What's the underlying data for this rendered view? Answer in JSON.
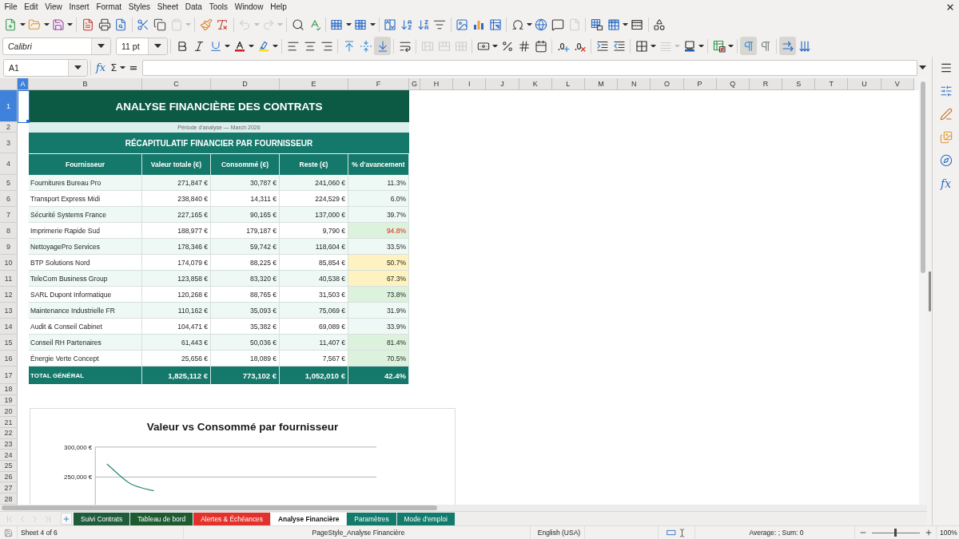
{
  "menu": [
    "File",
    "Edit",
    "View",
    "Insert",
    "Format",
    "Styles",
    "Sheet",
    "Data",
    "Tools",
    "Window",
    "Help"
  ],
  "toolbar_standard": [
    [
      {
        "kind": "new",
        "dropdown": true,
        "disabled": false
      },
      {
        "kind": "open",
        "dropdown": true,
        "disabled": false
      },
      {
        "kind": "save",
        "dropdown": true,
        "disabled": false
      }
    ],
    [
      {
        "kind": "export_pdf",
        "dropdown": false,
        "disabled": false
      },
      {
        "kind": "print",
        "dropdown": false,
        "disabled": false
      },
      {
        "kind": "print_preview",
        "dropdown": false,
        "disabled": false
      }
    ],
    [
      {
        "kind": "cut",
        "dropdown": false,
        "disabled": false
      },
      {
        "kind": "copy",
        "dropdown": false,
        "disabled": false
      },
      {
        "kind": "paste",
        "dropdown": true,
        "disabled": true
      }
    ],
    [
      {
        "kind": "clone",
        "dropdown": false,
        "disabled": false
      },
      {
        "kind": "clear",
        "dropdown": false,
        "disabled": false
      }
    ],
    [
      {
        "kind": "undo",
        "dropdown": true,
        "disabled": true
      },
      {
        "kind": "redo",
        "dropdown": true,
        "disabled": true
      }
    ],
    [
      {
        "kind": "find",
        "dropdown": false,
        "disabled": false
      },
      {
        "kind": "spelling",
        "dropdown": false,
        "disabled": false
      }
    ],
    [
      {
        "kind": "rows",
        "dropdown": true,
        "disabled": false
      },
      {
        "kind": "columns",
        "dropdown": true,
        "disabled": false
      }
    ],
    [
      {
        "kind": "sort",
        "dropdown": false,
        "disabled": false
      },
      {
        "kind": "sort_ascending",
        "dropdown": false,
        "disabled": false
      },
      {
        "kind": "sort_descending",
        "dropdown": false,
        "disabled": false
      },
      {
        "kind": "autofilter",
        "dropdown": false,
        "disabled": false
      }
    ],
    [
      {
        "kind": "image",
        "dropdown": false,
        "disabled": false
      },
      {
        "kind": "chart",
        "dropdown": false,
        "disabled": false
      },
      {
        "kind": "pivot_table",
        "dropdown": false,
        "disabled": false
      }
    ],
    [
      {
        "kind": "special_character",
        "dropdown": true,
        "disabled": false
      },
      {
        "kind": "hyperlink",
        "dropdown": false,
        "disabled": false
      },
      {
        "kind": "comment",
        "dropdown": false,
        "disabled": false
      },
      {
        "kind": "header_footer",
        "dropdown": false,
        "disabled": true
      }
    ],
    [
      {
        "kind": "print_area",
        "dropdown": false,
        "disabled": false
      },
      {
        "kind": "freeze",
        "dropdown": true,
        "disabled": false
      },
      {
        "kind": "split_window",
        "dropdown": false,
        "disabled": false
      }
    ],
    [
      {
        "kind": "draw_functions",
        "dropdown": false,
        "disabled": false
      }
    ]
  ],
  "font_name": "Calibri",
  "font_size": "11 pt",
  "toolbar_formatting": [
    [
      {
        "kind": "bold",
        "dropdown": false,
        "disabled": false,
        "pressed": false
      },
      {
        "kind": "italic",
        "dropdown": false,
        "disabled": false,
        "pressed": false
      },
      {
        "kind": "underline",
        "dropdown": true,
        "disabled": false,
        "pressed": false
      },
      {
        "kind": "font_color",
        "dropdown": true,
        "disabled": false,
        "pressed": false
      },
      {
        "kind": "highlight",
        "dropdown": true,
        "disabled": false,
        "pressed": false
      }
    ],
    [
      {
        "kind": "align_left",
        "dropdown": false,
        "disabled": false,
        "pressed": false
      },
      {
        "kind": "align_center",
        "dropdown": false,
        "disabled": false,
        "pressed": false
      },
      {
        "kind": "align_right",
        "dropdown": false,
        "disabled": false,
        "pressed": false
      }
    ],
    [
      {
        "kind": "align_top",
        "dropdown": false,
        "disabled": false,
        "pressed": false
      },
      {
        "kind": "align_middle",
        "dropdown": false,
        "disabled": false,
        "pressed": false
      },
      {
        "kind": "align_bottom",
        "dropdown": false,
        "disabled": false,
        "pressed": true
      }
    ],
    [
      {
        "kind": "wrap",
        "dropdown": false,
        "disabled": false,
        "pressed": false
      }
    ],
    [
      {
        "kind": "merge_center",
        "dropdown": false,
        "disabled": true,
        "pressed": false
      },
      {
        "kind": "merge",
        "dropdown": false,
        "disabled": true,
        "pressed": false
      },
      {
        "kind": "unmerge",
        "dropdown": false,
        "disabled": true,
        "pressed": false
      }
    ],
    [
      {
        "kind": "currency",
        "dropdown": true,
        "disabled": false,
        "pressed": false
      },
      {
        "kind": "percent",
        "dropdown": false,
        "disabled": false,
        "pressed": false
      },
      {
        "kind": "number",
        "dropdown": false,
        "disabled": false,
        "pressed": false
      },
      {
        "kind": "date",
        "dropdown": false,
        "disabled": false,
        "pressed": false
      }
    ],
    [
      {
        "kind": "add_decimal",
        "dropdown": false,
        "disabled": false,
        "pressed": false
      },
      {
        "kind": "delete_decimal",
        "dropdown": false,
        "disabled": false,
        "pressed": false
      }
    ],
    [
      {
        "kind": "indent_increase",
        "dropdown": false,
        "disabled": false,
        "pressed": false
      },
      {
        "kind": "indent_decrease",
        "dropdown": false,
        "disabled": false,
        "pressed": false
      }
    ],
    [
      {
        "kind": "borders",
        "dropdown": true,
        "disabled": false,
        "pressed": false
      },
      {
        "kind": "border_style",
        "dropdown": true,
        "disabled": true,
        "pressed": false
      },
      {
        "kind": "border_color",
        "dropdown": true,
        "disabled": false,
        "pressed": false
      }
    ],
    [
      {
        "kind": "conditional",
        "dropdown": true,
        "disabled": false,
        "pressed": false
      }
    ],
    [
      {
        "kind": "ltr",
        "dropdown": false,
        "disabled": false,
        "pressed": true
      },
      {
        "kind": "rtl",
        "dropdown": false,
        "disabled": false,
        "pressed": false
      }
    ],
    [
      {
        "kind": "text_ltr",
        "dropdown": false,
        "disabled": false,
        "pressed": true
      },
      {
        "kind": "text_vertical",
        "dropdown": false,
        "disabled": false,
        "pressed": false
      }
    ]
  ],
  "formula_bar": {
    "name_box": "A1",
    "function_wizard": "fx",
    "sum": "Σ",
    "equals": "="
  },
  "sheet": {
    "column_headers": [
      {
        "label": "A",
        "selected": true
      },
      {
        "label": "B",
        "selected": false
      },
      {
        "label": "C",
        "selected": false
      },
      {
        "label": "D",
        "selected": false
      },
      {
        "label": "E",
        "selected": false
      },
      {
        "label": "F",
        "selected": false
      },
      {
        "label": "G",
        "selected": false
      },
      {
        "label": "H",
        "selected": false
      },
      {
        "label": "I",
        "selected": false
      },
      {
        "label": "J",
        "selected": false
      },
      {
        "label": "K",
        "selected": false
      },
      {
        "label": "L",
        "selected": false
      },
      {
        "label": "M",
        "selected": false
      },
      {
        "label": "N",
        "selected": false
      },
      {
        "label": "O",
        "selected": false
      },
      {
        "label": "P",
        "selected": false
      },
      {
        "label": "Q",
        "selected": false
      },
      {
        "label": "R",
        "selected": false
      },
      {
        "label": "S",
        "selected": false
      },
      {
        "label": "T",
        "selected": false
      },
      {
        "label": "U",
        "selected": false
      },
      {
        "label": "V",
        "selected": false
      }
    ],
    "row_headers": [
      {
        "label": "1",
        "selected": true
      },
      {
        "label": "2",
        "selected": false
      },
      {
        "label": "3",
        "selected": false
      },
      {
        "label": "4",
        "selected": false
      },
      {
        "label": "5",
        "selected": false
      },
      {
        "label": "6",
        "selected": false
      },
      {
        "label": "7",
        "selected": false
      },
      {
        "label": "8",
        "selected": false
      },
      {
        "label": "9",
        "selected": false
      },
      {
        "label": "10",
        "selected": false
      },
      {
        "label": "11",
        "selected": false
      },
      {
        "label": "12",
        "selected": false
      },
      {
        "label": "13",
        "selected": false
      },
      {
        "label": "14",
        "selected": false
      },
      {
        "label": "15",
        "selected": false
      },
      {
        "label": "16",
        "selected": false
      },
      {
        "label": "17",
        "selected": false
      },
      {
        "label": "18",
        "selected": false
      },
      {
        "label": "19",
        "selected": false
      },
      {
        "label": "20",
        "selected": false
      },
      {
        "label": "21",
        "selected": false
      },
      {
        "label": "22",
        "selected": false
      },
      {
        "label": "23",
        "selected": false
      },
      {
        "label": "24",
        "selected": false
      },
      {
        "label": "25",
        "selected": false
      },
      {
        "label": "26",
        "selected": false
      },
      {
        "label": "27",
        "selected": false
      },
      {
        "label": "28",
        "selected": false
      }
    ],
    "title": "ANALYSE FINANCIÈRE DES CONTRATS",
    "period": "Période d'analyse — March 2026",
    "section": "RÉCAPITULATIF FINANCIER PAR FOURNISSEUR",
    "table": {
      "columns": [
        "Fournisseur",
        "Valeur totale (€)",
        "Consommé (€)",
        "Reste (€)",
        "% d'avancement"
      ],
      "rows": [
        {
          "cells": [
            "Fournitures Bureau Pro",
            "271,847 €",
            "30,787 €",
            "241,060 €",
            "11.3%"
          ],
          "watch": false,
          "reached": false,
          "overrun": false
        },
        {
          "cells": [
            "Transport Express Midi",
            "238,840 €",
            "14,311 €",
            "224,529 €",
            "6.0%"
          ],
          "watch": false,
          "reached": false,
          "overrun": false
        },
        {
          "cells": [
            "Sécurité Systems France",
            "227,165 €",
            "90,165 €",
            "137,000 €",
            "39.7%"
          ],
          "watch": false,
          "reached": false,
          "overrun": false
        },
        {
          "cells": [
            "Imprimerie Rapide Sud",
            "188,977 €",
            "179,187 €",
            "9,790 €",
            "94.8%"
          ],
          "watch": false,
          "reached": true,
          "overrun": true
        },
        {
          "cells": [
            "NettoyagePro Services",
            "178,346 €",
            "59,742 €",
            "118,604 €",
            "33.5%"
          ],
          "watch": false,
          "reached": false,
          "overrun": false
        },
        {
          "cells": [
            "BTP Solutions Nord",
            "174,079 €",
            "88,225 €",
            "85,854 €",
            "50.7%"
          ],
          "watch": true,
          "reached": false,
          "overrun": false
        },
        {
          "cells": [
            "TeleCom Business Group",
            "123,858 €",
            "83,320 €",
            "40,538 €",
            "67.3%"
          ],
          "watch": true,
          "reached": false,
          "overrun": false
        },
        {
          "cells": [
            "SARL Dupont Informatique",
            "120,268 €",
            "88,765 €",
            "31,503 €",
            "73.8%"
          ],
          "watch": false,
          "reached": true,
          "overrun": false
        },
        {
          "cells": [
            "Maintenance Industrielle FR",
            "110,162 €",
            "35,093 €",
            "75,069 €",
            "31.9%"
          ],
          "watch": false,
          "reached": false,
          "overrun": false
        },
        {
          "cells": [
            "Audit & Conseil Cabinet",
            "104,471 €",
            "35,382 €",
            "69,089 €",
            "33.9%"
          ],
          "watch": false,
          "reached": false,
          "overrun": false
        },
        {
          "cells": [
            "Conseil RH Partenaires",
            "61,443 €",
            "50,036 €",
            "11,407 €",
            "81.4%"
          ],
          "watch": false,
          "reached": true,
          "overrun": false
        },
        {
          "cells": [
            "Énergie Verte Concept",
            "25,656 €",
            "18,089 €",
            "7,567 €",
            "70.5%"
          ],
          "watch": false,
          "reached": true,
          "overrun": false
        }
      ],
      "total": [
        "TOTAL GÉNÉRAL",
        "1,825,112 €",
        "773,102 €",
        "1,052,010 €",
        "42.4%"
      ]
    },
    "chart": {
      "chart_data": {
        "type": "line",
        "title": "Valeur vs Consommé par fournisseur",
        "categories": [
          null,
          null,
          null,
          null,
          null,
          null,
          null,
          null,
          null,
          null,
          null,
          null
        ],
        "ylim": [
          0,
          300000
        ],
        "yticks": [
          {
            "value": 250000,
            "label": "250,000 €"
          },
          {
            "value": 300000,
            "label": "300,000 €"
          }
        ],
        "series": [
          {
            "color": "#2e8b7b",
            "values": [
              271847,
              238840,
              227165,
              null,
              null,
              null,
              null,
              null,
              null,
              null,
              null,
              null
            ]
          }
        ]
      }
    }
  },
  "sheet_navigation": {
    "disabled": true
  },
  "sheet_tabs": [
    {
      "label": "Suivi Contrats",
      "selected": false,
      "color": "#1e5c3c"
    },
    {
      "label": "Tableau de bord",
      "selected": false,
      "color": "#1d5a30"
    },
    {
      "label": "Alertes & Échéances",
      "selected": false,
      "color": "#e3322b"
    },
    {
      "label": "Analyse Financière",
      "selected": true
    },
    {
      "label": "Paramètres",
      "selected": false,
      "color": "#127b6c"
    },
    {
      "label": "Mode d'emploi",
      "selected": false,
      "color": "#127b6c"
    }
  ],
  "status_bar": {
    "sheet": "Sheet 4 of 6",
    "page_style": "PageStyle_Analyse Financière",
    "language": "English (USA)",
    "summary": "Average: ; Sum: 0",
    "zoom": {
      "level": 0.5,
      "label": "100%"
    }
  },
  "sidebar": {
    "functions": "fx"
  }
}
